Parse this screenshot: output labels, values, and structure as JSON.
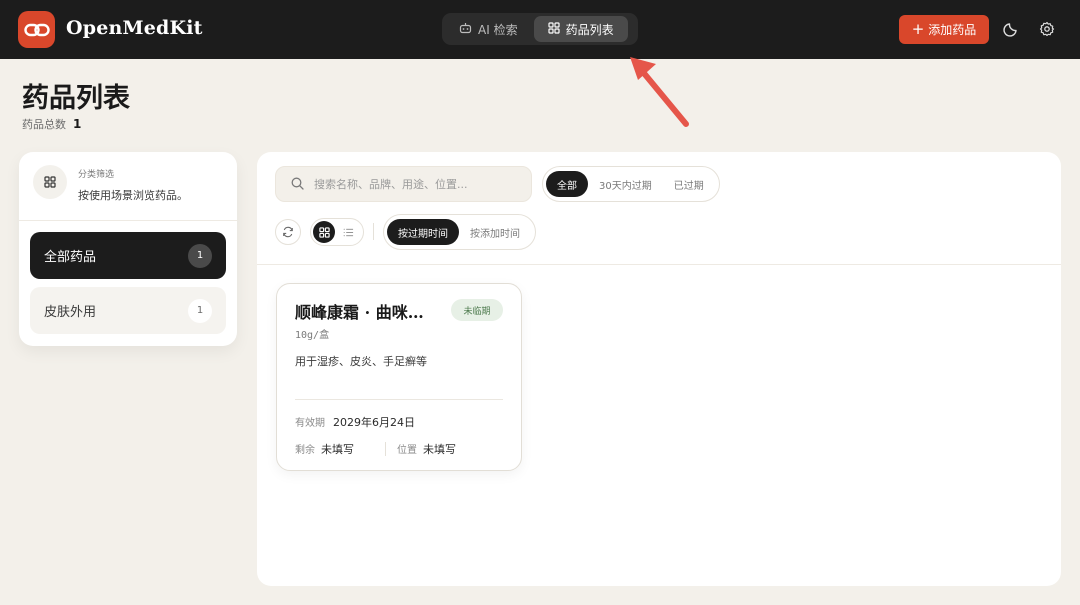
{
  "app": {
    "title": "OpenMedKit"
  },
  "nav": {
    "tabs": [
      {
        "label": "AI 检索",
        "icon": "robot-icon",
        "active": false
      },
      {
        "label": "药品列表",
        "icon": "grid-icon",
        "active": true
      }
    ],
    "add_button": "添加药品"
  },
  "page": {
    "title": "药品列表",
    "count_label": "药品总数",
    "count_value": "1"
  },
  "sidebar": {
    "label": "分类筛选",
    "desc": "按使用场景浏览药品。",
    "items": [
      {
        "label": "全部药品",
        "count": "1",
        "active": true
      },
      {
        "label": "皮肤外用",
        "count": "1",
        "active": false
      }
    ]
  },
  "toolbar": {
    "search_placeholder": "搜索名称、品牌、用途、位置...",
    "filters": [
      "全部",
      "30天内过期",
      "已过期"
    ],
    "sorts": [
      "按过期时间",
      "按添加时间"
    ]
  },
  "card": {
    "title": "顺峰康霜 · 曲咪…",
    "badge": "未临期",
    "spec": "10g/盒",
    "usage": "用于湿疹、皮炎、手足癣等",
    "expiry_label": "有效期",
    "expiry_value": "2029年6月24日",
    "remaining_label": "剩余",
    "remaining_value": "未填写",
    "location_label": "位置",
    "location_value": "未填写"
  },
  "colors": {
    "accent": "#d9472b",
    "topbar": "#1c1c1c",
    "background": "#f3f0ea"
  }
}
